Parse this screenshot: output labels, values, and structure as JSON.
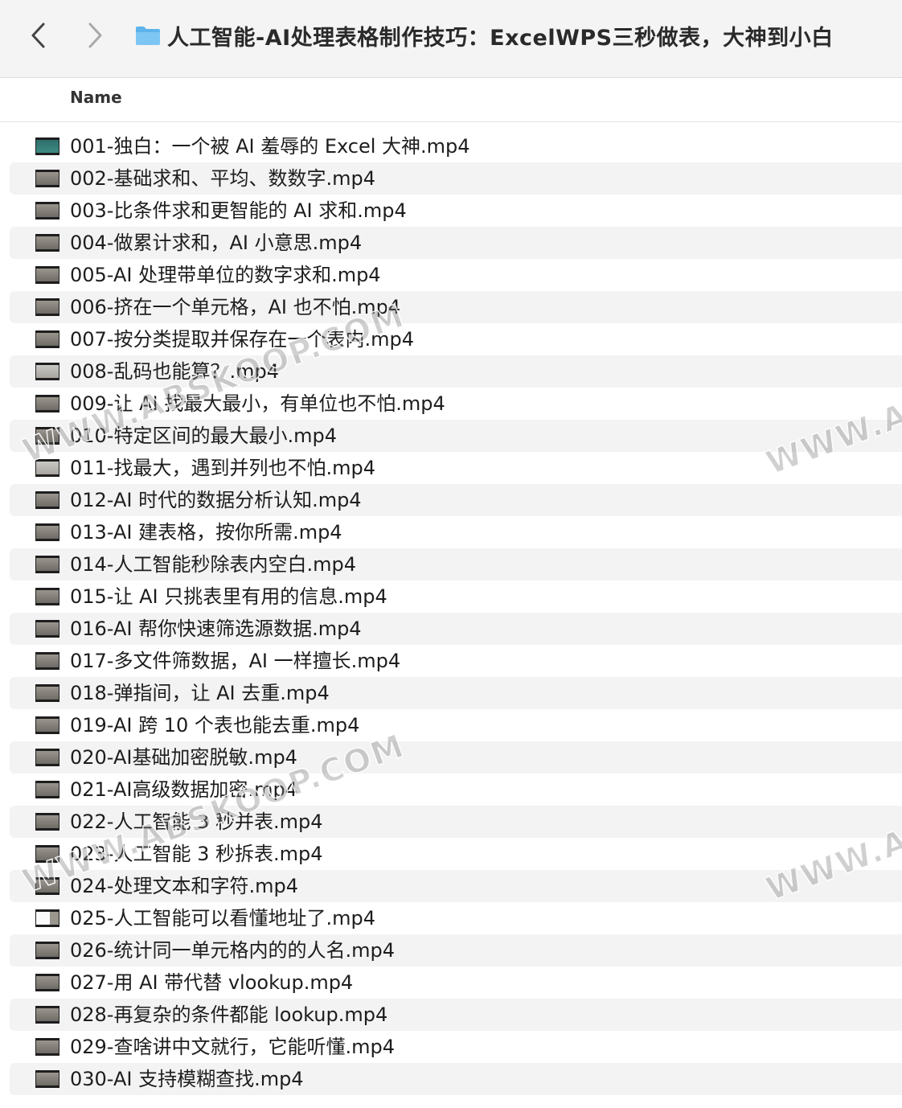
{
  "window": {
    "title": "人工智能-AI处理表格制作技巧：ExcelWPS三秒做表，大神到小白",
    "back_icon": "chevron-left-icon",
    "forward_icon": "chevron-right-icon",
    "folder_icon": "folder-icon",
    "folder_color": "#5db4ec"
  },
  "list_header": {
    "name": "Name"
  },
  "files": [
    {
      "name": "001-独白：一个被 AI 羞辱的 Excel 大神.mp4",
      "thumb": "green"
    },
    {
      "name": "002-基础求和、平均、数数字.mp4",
      "thumb": "dark"
    },
    {
      "name": "003-比条件求和更智能的 AI 求和.mp4",
      "thumb": "dark"
    },
    {
      "name": "004-做累计求和，AI 小意思.mp4",
      "thumb": "dark"
    },
    {
      "name": "005-AI 处理带单位的数字求和.mp4",
      "thumb": "dark"
    },
    {
      "name": "006-挤在一个单元格，AI 也不怕.mp4",
      "thumb": "dark"
    },
    {
      "name": "007-按分类提取并保存在一个表内.mp4",
      "thumb": "dark"
    },
    {
      "name": "008-乱码也能算？.mp4",
      "thumb": "light"
    },
    {
      "name": "009-让 AI 找最大最小，有单位也不怕.mp4",
      "thumb": "dark"
    },
    {
      "name": "010-特定区间的最大最小.mp4",
      "thumb": "dark"
    },
    {
      "name": "011-找最大，遇到并列也不怕.mp4",
      "thumb": "light"
    },
    {
      "name": "012-AI 时代的数据分析认知.mp4",
      "thumb": "dark"
    },
    {
      "name": "013-AI 建表格，按你所需.mp4",
      "thumb": "dark"
    },
    {
      "name": "014-人工智能秒除表内空白.mp4",
      "thumb": "dark"
    },
    {
      "name": "015-让 AI 只挑表里有用的信息.mp4",
      "thumb": "dark"
    },
    {
      "name": "016-AI 帮你快速筛选源数据.mp4",
      "thumb": "dark"
    },
    {
      "name": "017-多文件筛数据，AI 一样擅长.mp4",
      "thumb": "dark"
    },
    {
      "name": "018-弹指间，让 AI 去重.mp4",
      "thumb": "dark"
    },
    {
      "name": "019-AI 跨 10 个表也能去重.mp4",
      "thumb": "dark"
    },
    {
      "name": "020-AI基础加密脱敏.mp4",
      "thumb": "dark"
    },
    {
      "name": "021-AI高级数据加密.mp4",
      "thumb": "dark"
    },
    {
      "name": "022-人工智能 3 秒并表.mp4",
      "thumb": "dark"
    },
    {
      "name": "023-人工智能 3 秒拆表.mp4",
      "thumb": "dark"
    },
    {
      "name": "024-处理文本和字符.mp4",
      "thumb": "dark"
    },
    {
      "name": "025-人工智能可以看懂地址了.mp4",
      "thumb": "white"
    },
    {
      "name": "026-统计同一单元格内的的人名.mp4",
      "thumb": "dark"
    },
    {
      "name": "027-用 AI 带代替 vlookup.mp4",
      "thumb": "dark"
    },
    {
      "name": "028-再复杂的条件都能 lookup.mp4",
      "thumb": "dark"
    },
    {
      "name": "029-查啥讲中文就行，它能听懂.mp4",
      "thumb": "dark"
    },
    {
      "name": "030-AI 支持模糊查找.mp4",
      "thumb": "dark"
    }
  ],
  "watermarks": [
    "WWW.ABSKOOP.COM",
    "WWW.ABSKOOP.COM",
    "WWW.AB",
    "WWW.AB",
    "WWW.ABSKOOP.COM",
    "WWW.ABSKOOP.COM"
  ]
}
